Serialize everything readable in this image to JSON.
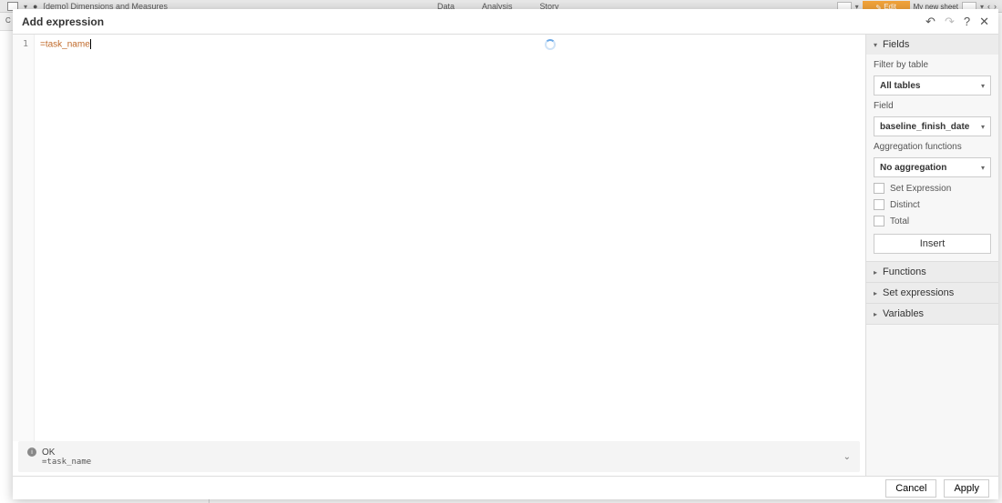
{
  "bg": {
    "app_title": "[demo] Dimensions and Measures",
    "menu": {
      "data": "Data",
      "analysis": "Analysis",
      "story": "Story"
    },
    "edit_btn": "Edit",
    "sheet_label": "My new sheet",
    "left_panel_title": "C"
  },
  "modal": {
    "title": "Add expression",
    "line_no": "1",
    "code": "=task_name",
    "status_ok": "OK",
    "status_value": "=task_name",
    "footer": {
      "cancel": "Cancel",
      "apply": "Apply"
    }
  },
  "fields": {
    "section": "Fields",
    "filter_label": "Filter by table",
    "filter_value": "All tables",
    "field_label": "Field",
    "field_value": "baseline_finish_date",
    "agg_label": "Aggregation functions",
    "agg_value": "No aggregation",
    "chk_setexpr": "Set Expression",
    "chk_distinct": "Distinct",
    "chk_total": "Total",
    "insert": "Insert"
  },
  "sections": {
    "functions": "Functions",
    "setexpr": "Set expressions",
    "variables": "Variables"
  }
}
